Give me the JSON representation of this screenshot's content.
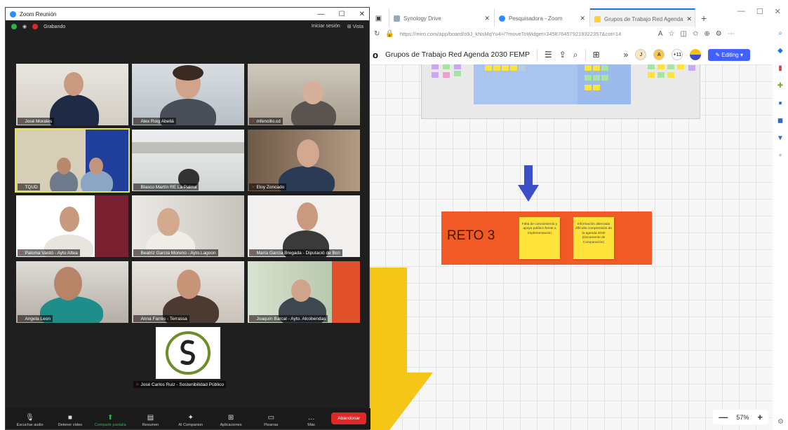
{
  "browser": {
    "tabs": [
      {
        "label": "Synology Drive",
        "active": false
      },
      {
        "label": "Pesquisadora - Zoom",
        "active": false
      },
      {
        "label": "Grupos de Trabajo Red Agenda",
        "active": true
      }
    ],
    "url": "https://miro.com/app/board/o9J_kNsMqYu4=/?moveToWidget=3458764579219322357&cot=14",
    "window_controls": [
      "—",
      "☐",
      "✕"
    ]
  },
  "miro": {
    "board_title": "Grupos de Trabajo Red Agenda 2030 FEMP",
    "avatars": [
      "J",
      "A",
      "+11"
    ],
    "editing_label": "Editing",
    "reto_label": "RETO 3",
    "notes": [
      "Falta de conocimiento y apoyo político frente a implementación",
      "Información alternada difículta comprensión de la agenda 2030 (Documento de Comparación)"
    ],
    "zoom_level": "57%",
    "zoom_minus": "—",
    "zoom_plus": "+"
  },
  "zoom_app": {
    "title": "Zoom Reunión",
    "status_label": "Grabando",
    "top_right": [
      "Iniciar sesión",
      "Vista"
    ],
    "participants": [
      "José Morales",
      "Alex Roig Abellá",
      "mfencillo.cd",
      "TQUD",
      "Blasco Martín RE La Palma",
      "Eloy Zoncado",
      "Paloma Vardó - Ayto Altea",
      "Beatriz García Moreno - Ayto.Lagoon",
      "María García Bregada - Diputació de Bcn",
      "Angela Leon",
      "Anna Farrés - Terrassa",
      "Joaquín Barcal - Ayto. Alcobendas",
      "José Carlos Ruiz - Sostenibilidad Público"
    ],
    "toolbar": [
      {
        "label": "Escuchar audio",
        "glyph": "🎙"
      },
      {
        "label": "Detener vídeo",
        "glyph": "■"
      },
      {
        "label": "Compartir pantalla",
        "glyph": "⬆"
      },
      {
        "label": "Resumen",
        "glyph": "▤"
      },
      {
        "label": "AI Companion",
        "glyph": "✦"
      },
      {
        "label": "Aplicaciones",
        "glyph": "⊞"
      },
      {
        "label": "Pizarras",
        "glyph": "▭"
      },
      {
        "label": "Más",
        "glyph": "…"
      }
    ],
    "end_label": "Abandonar"
  }
}
